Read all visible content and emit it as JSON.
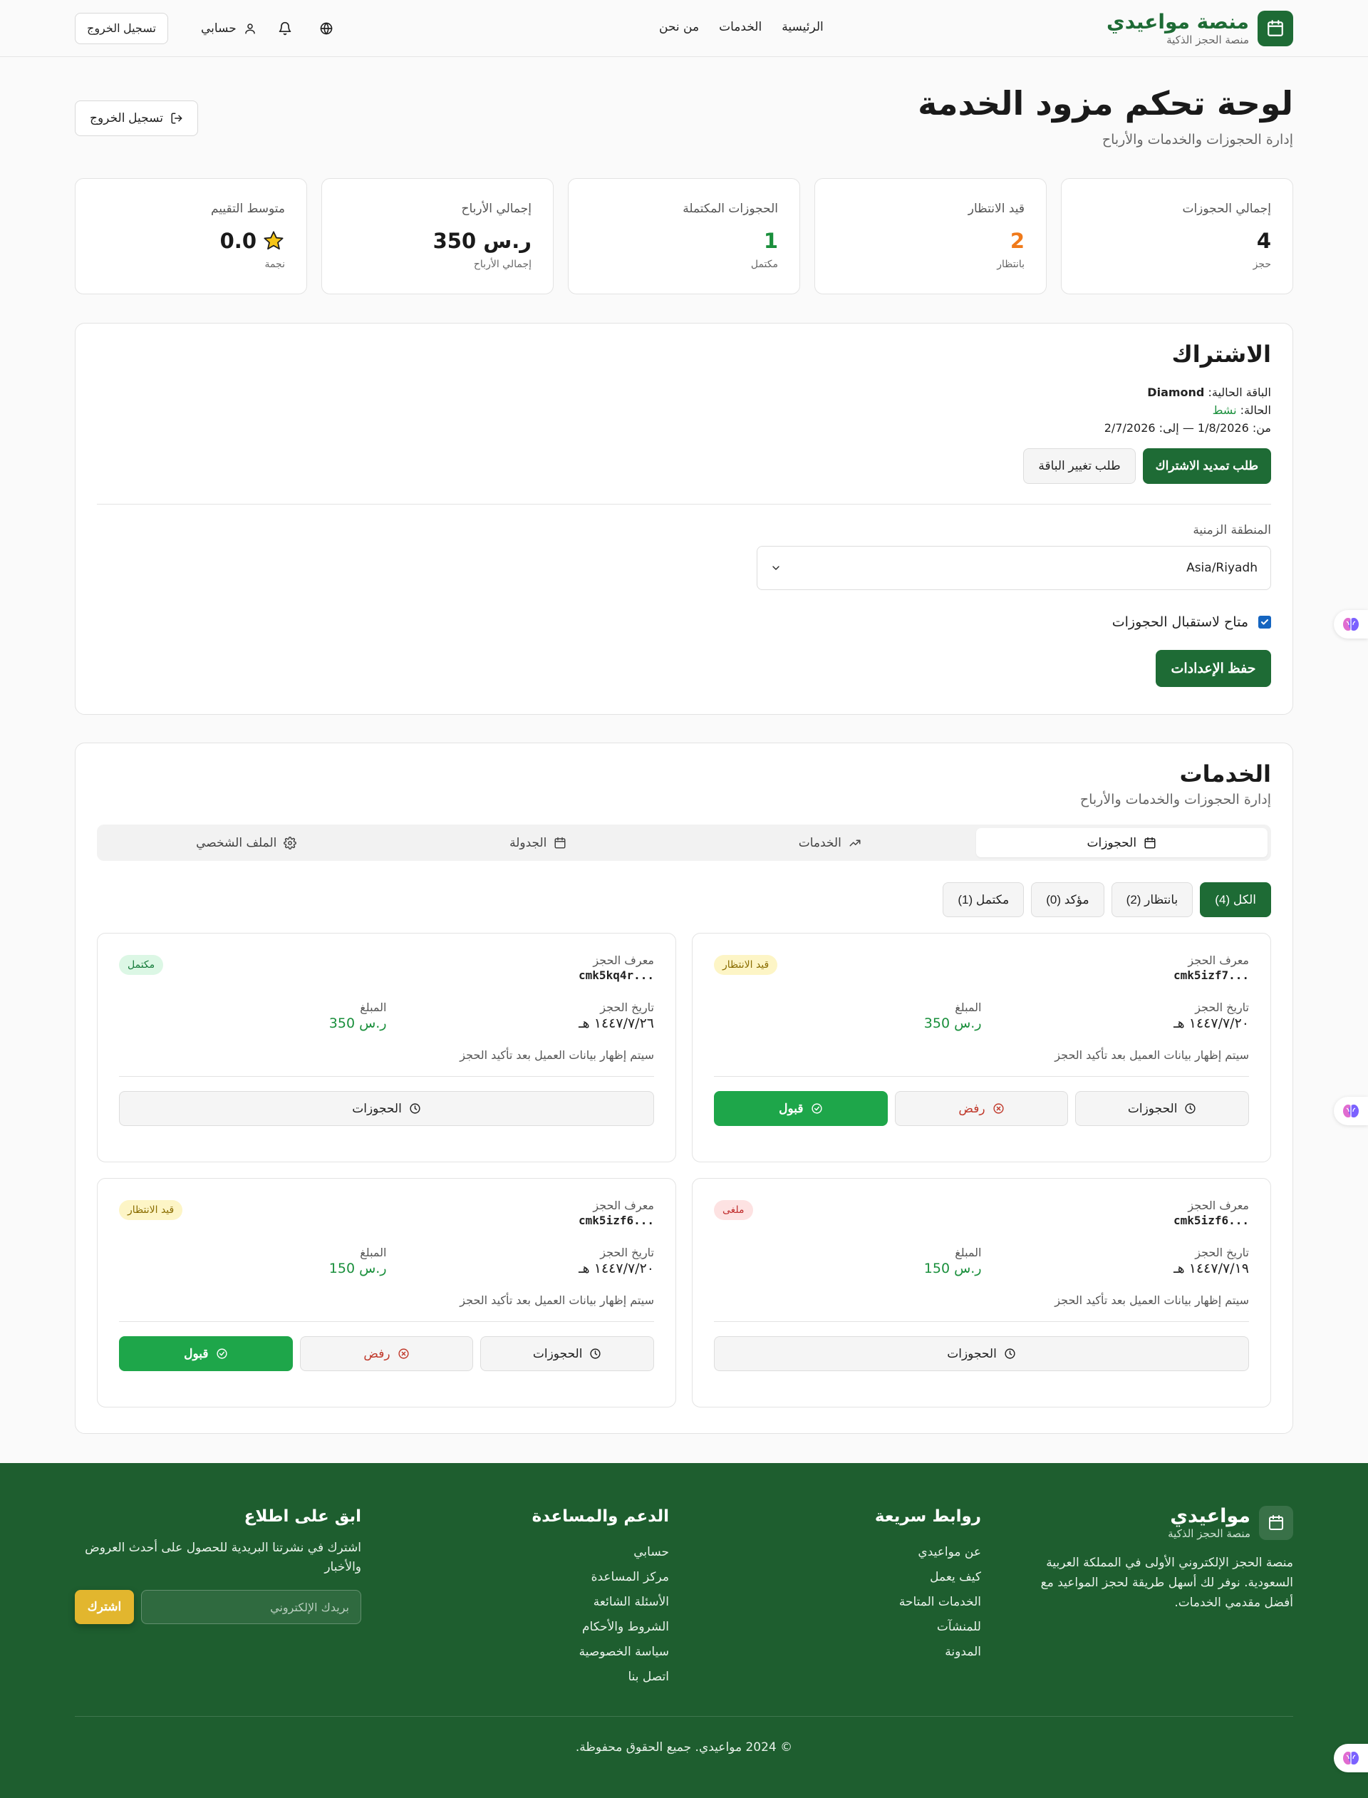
{
  "brand": {
    "name": "منصة مواعيدي",
    "tagline": "منصة الحجز الذكية"
  },
  "nav": {
    "home": "الرئيسية",
    "services": "الخدمات",
    "about": "من نحن"
  },
  "header_actions": {
    "account": "حسابي",
    "logout": "تسجيل الخروج"
  },
  "page": {
    "title": "لوحة تحكم مزود الخدمة",
    "subtitle": "إدارة الحجوزات والخدمات والأرباح",
    "logout": "تسجيل الخروج"
  },
  "stats": [
    {
      "label": "إجمالي الحجوزات",
      "value": "4",
      "unit": "حجز",
      "color": "#1a1a1a"
    },
    {
      "label": "قيد الانتظار",
      "value": "2",
      "unit": "بانتظار",
      "color": "#f07a1a"
    },
    {
      "label": "الحجوزات المكتملة",
      "value": "1",
      "unit": "مكتمل",
      "color": "#1a8f3c"
    },
    {
      "label": "إجمالي الأرباح",
      "value": "ر.س 350",
      "unit": "إجمالي الأرباح",
      "color": "#1a1a1a"
    },
    {
      "label": "متوسط التقييم",
      "value": "0.0",
      "unit": "نجمة",
      "color": "#1a1a1a"
    }
  ],
  "subscription": {
    "title": "الاشتراك",
    "plan_label": "الباقة الحالية:",
    "plan": "Diamond",
    "status_label": "الحالة:",
    "status": "نشط",
    "period": "من: 1/8/2026 — إلى: 2/7/2026",
    "renew": "طلب تمديد الاشتراك",
    "change": "طلب تغيير الباقة",
    "timezone_label": "المنطقة الزمنية",
    "timezone": "Asia/Riyadh",
    "available_label": "متاح لاستقبال الحجوزات",
    "save": "حفظ الإعدادات"
  },
  "services": {
    "title": "الخدمات",
    "subtitle": "إدارة الحجوزات والخدمات والأرباح",
    "tabs": [
      "الحجوزات",
      "الخدمات",
      "الجدولة",
      "الملف الشخصي"
    ],
    "filters": [
      "الكل (4)",
      "بانتظار (2)",
      "مؤكد (0)",
      "مكتمل (1)"
    ]
  },
  "booking_labels": {
    "id": "معرف الحجز",
    "amount": "المبلغ",
    "date": "تاريخ الحجز",
    "note": "سيتم إظهار بيانات العميل بعد تأكيد الحجز",
    "bookings": "الحجوزات",
    "reject": "رفض",
    "accept": "قبول"
  },
  "bookings": [
    {
      "id": "cmk5izf7...",
      "status": "قيد الانتظار",
      "amount": "ر.س 350",
      "date": "١٤٤٧/٧/٢٠ هـ"
    },
    {
      "id": "cmk5kq4r...",
      "status": "مكتمل",
      "amount": "ر.س 350",
      "date": "١٤٤٧/٧/٢٦ هـ"
    },
    {
      "id": "cmk5izf6...",
      "status": "ملغى",
      "amount": "ر.س 150",
      "date": "١٤٤٧/٧/١٩ هـ"
    },
    {
      "id": "cmk5izf6...",
      "status": "قيد الانتظار",
      "amount": "ر.س 150",
      "date": "١٤٤٧/٧/٢٠ هـ"
    }
  ],
  "footer": {
    "brand": "مواعيدي",
    "tagline": "منصة الحجز الذكية",
    "description": "منصة الحجز الإلكتروني الأولى في المملكة العربية السعودية. نوفر لك أسهل طريقة لحجز المواعيد مع أفضل مقدمي الخدمات.",
    "quick_title": "روابط سريعة",
    "quick_links": [
      "عن مواعيدي",
      "كيف يعمل",
      "الخدمات المتاحة",
      "للمنشآت",
      "المدونة"
    ],
    "support_title": "الدعم والمساعدة",
    "support_links": [
      "حسابي",
      "مركز المساعدة",
      "الأسئلة الشائعة",
      "الشروط والأحكام",
      "سياسة الخصوصية",
      "اتصل بنا"
    ],
    "news_title": "ابق على اطلاع",
    "news_text": "اشترك في نشرتنا البريدية للحصول على أحدث العروض والأخبار",
    "email_placeholder": "بريدك الإلكتروني",
    "subscribe": "اشترك",
    "copyright": "© 2024 مواعيدي. جميع الحقوق محفوظة."
  },
  "colors": {
    "primary": "#1e6b35",
    "accent_green": "#1ea64a",
    "pending": "#f07a1a",
    "footer": "#1e5e2f",
    "gold": "#e2b62e"
  }
}
